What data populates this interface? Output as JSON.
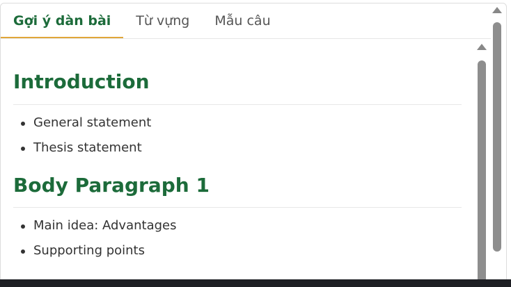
{
  "tabs": [
    {
      "label": "Gợi ý dàn bài",
      "active": true
    },
    {
      "label": "Từ vựng",
      "active": false
    },
    {
      "label": "Mẫu câu",
      "active": false
    }
  ],
  "sections": [
    {
      "title": "Introduction",
      "items": [
        "General statement",
        "Thesis statement"
      ]
    },
    {
      "title": "Body Paragraph 1",
      "items": [
        "Main idea: Advantages",
        "Supporting points"
      ]
    }
  ],
  "colors": {
    "accent_green": "#1c6b3a",
    "tab_underline": "#e0a63a",
    "scrollbar": "#8e8e8e"
  },
  "icons": {
    "scroll_up": "triangle-up-icon"
  }
}
